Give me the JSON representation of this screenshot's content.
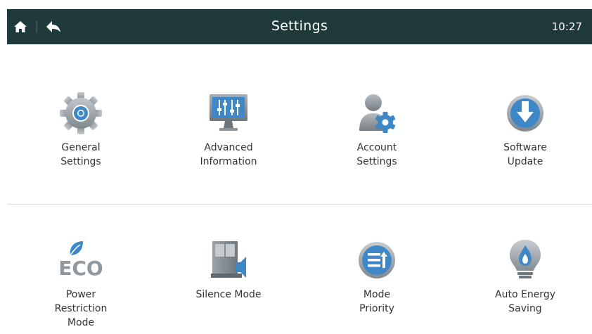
{
  "header": {
    "title": "Settings",
    "time": "10:27",
    "background_color": "#1e3a3b"
  },
  "tiles": [
    {
      "label": "General\nSettings",
      "icon": "gear-icon"
    },
    {
      "label": "Advanced\nInformation",
      "icon": "monitor-equalizer-icon"
    },
    {
      "label": "Account\nSettings",
      "icon": "user-gear-icon"
    },
    {
      "label": "Software\nUpdate",
      "icon": "download-arrow-icon"
    },
    {
      "label": "Power\nRestriction\nMode",
      "icon": "eco-leaf-icon"
    },
    {
      "label": "Silence Mode",
      "icon": "silence-unit-icon"
    },
    {
      "label": "Mode\nPriority",
      "icon": "priority-list-icon"
    },
    {
      "label": "Auto Energy\nSaving",
      "icon": "bulb-flame-icon"
    }
  ]
}
